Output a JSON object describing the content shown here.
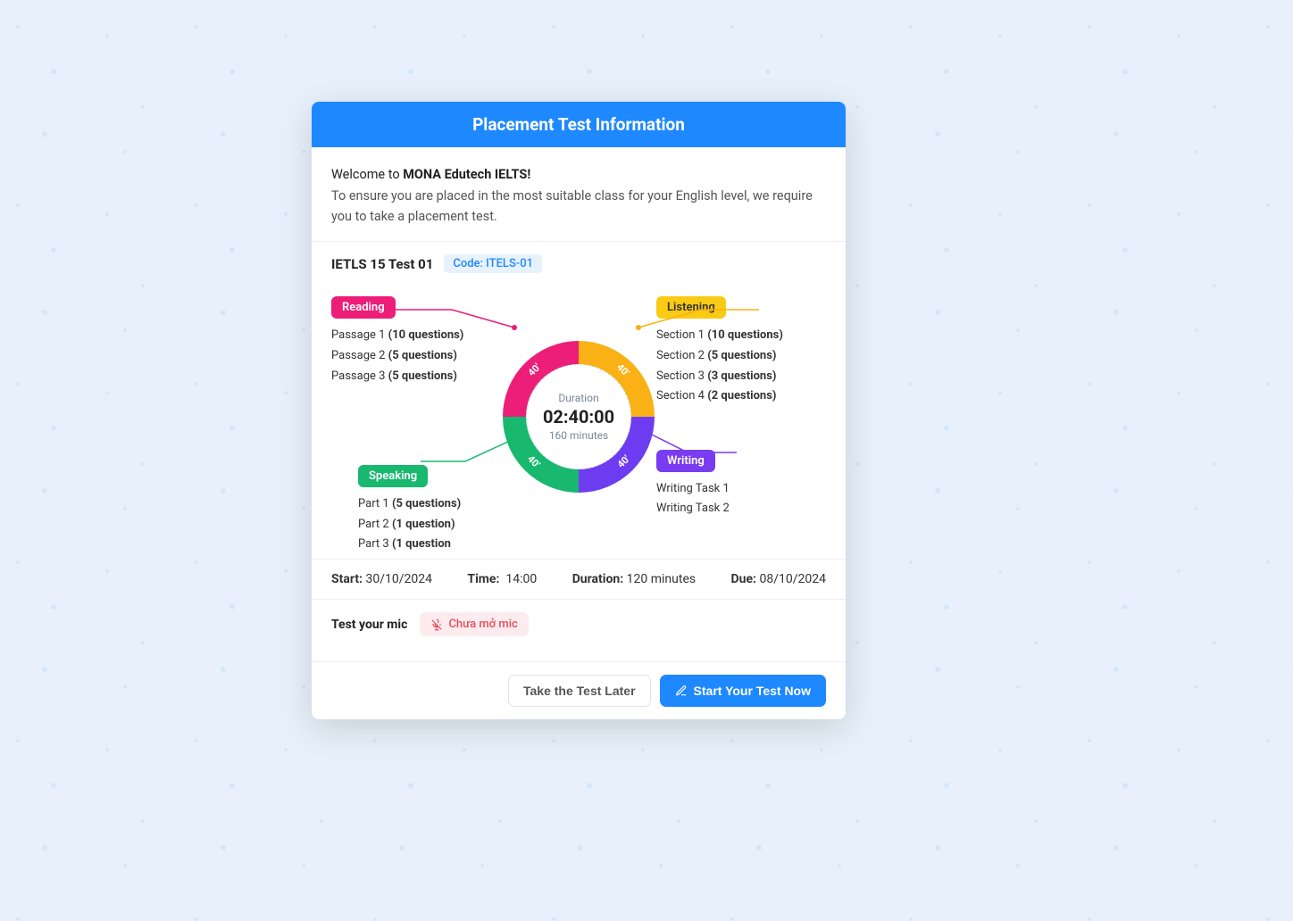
{
  "header": {
    "title": "Placement Test Information"
  },
  "welcome": {
    "prefix": "Welcome to ",
    "brand": "MONA Edutech IELTS!",
    "desc": "To ensure you are placed in the most suitable class for your English level, we require you to take a placement test."
  },
  "test": {
    "name": "IETLS 15 Test 01",
    "code": "Code: ITELS-01"
  },
  "chart_data": {
    "type": "pie",
    "title": "Duration",
    "center_time": "02:40:00",
    "center_minutes": "160 minutes",
    "segments": [
      {
        "name": "Reading",
        "minutes": 40,
        "label": "40'",
        "color": "#ec1e78"
      },
      {
        "name": "Listening",
        "minutes": 40,
        "label": "40'",
        "color": "#f9b115"
      },
      {
        "name": "Writing",
        "minutes": 40,
        "label": "40'",
        "color": "#6d3cf0"
      },
      {
        "name": "Speaking",
        "minutes": 40,
        "label": "40'",
        "color": "#18b86f"
      }
    ]
  },
  "sections": {
    "reading": {
      "label": "Reading",
      "items": [
        {
          "t": "Passage 1 ",
          "b": "(10 questions)"
        },
        {
          "t": "Passage 2 ",
          "b": "(5 questions)"
        },
        {
          "t": "Passage 3 ",
          "b": "(5 questions)"
        }
      ]
    },
    "listening": {
      "label": "Listening",
      "items": [
        {
          "t": "Section 1 ",
          "b": "(10 questions)"
        },
        {
          "t": "Section 2 ",
          "b": "(5 questions)"
        },
        {
          "t": "Section 3 ",
          "b": "(3 questions)"
        },
        {
          "t": "Section 4 ",
          "b": "(2 questions)"
        }
      ]
    },
    "speaking": {
      "label": "Speaking",
      "items": [
        {
          "t": "Part 1 ",
          "b": "(5 questions)"
        },
        {
          "t": "Part 2 ",
          "b": "(1 question)"
        },
        {
          "t": "Part 3 ",
          "b": "(1 question"
        }
      ]
    },
    "writing": {
      "label": "Writing",
      "items": [
        {
          "t": "Writing Task 1",
          "b": ""
        },
        {
          "t": "Writing Task 2",
          "b": ""
        }
      ]
    }
  },
  "meta": {
    "start_label": "Start:",
    "start": "30/10/2024",
    "time_label": "Time:",
    "time": "14:00",
    "duration_label": "Duration:",
    "duration": "120 minutes",
    "due_label": "Due:",
    "due": "08/10/2024"
  },
  "mic": {
    "label": "Test your mic",
    "status": "Chưa mở mic"
  },
  "footer": {
    "later": "Take the Test Later",
    "start": "Start Your Test Now"
  }
}
